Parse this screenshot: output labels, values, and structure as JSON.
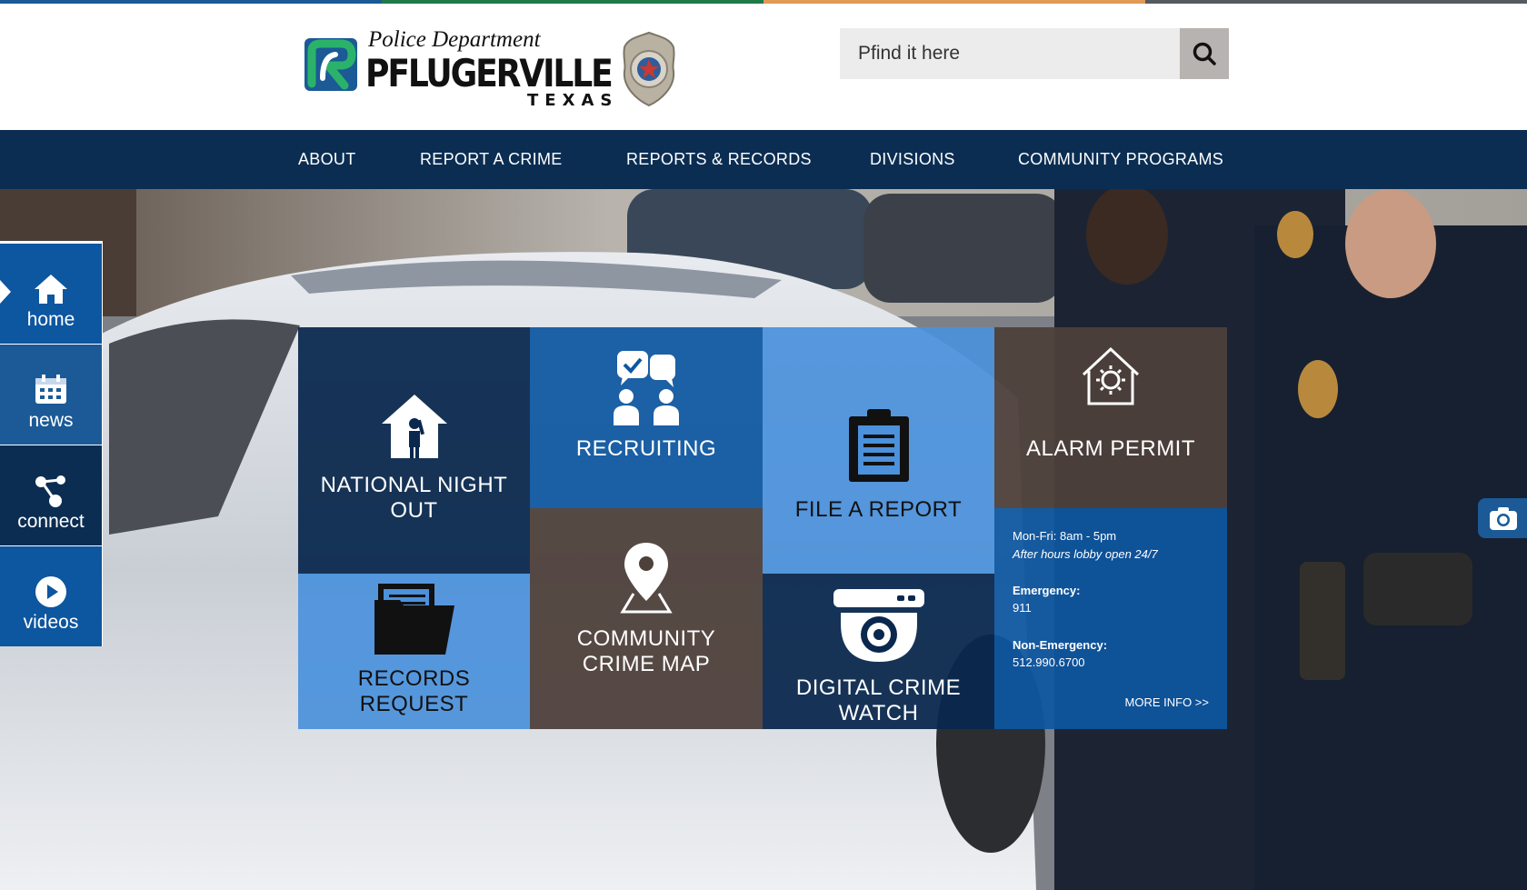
{
  "colors": {
    "stripe": [
      "#1b5a96",
      "#1f7a4a",
      "#e09a55",
      "#555a5f"
    ],
    "nav_bg": "#0b2d52",
    "tile_navy": "#0a284e",
    "tile_blue": "#0d56a0",
    "tile_light": "#4b91dc",
    "tile_brown": "#4e403a"
  },
  "logo": {
    "dept": "Police Department",
    "city": "PFLUGERVILLE",
    "state": "TEXAS",
    "badge_icon": "police-badge-icon"
  },
  "search": {
    "placeholder": "Pfind it here",
    "icon": "search-icon"
  },
  "nav": {
    "items": [
      "ABOUT",
      "REPORT A CRIME",
      "REPORTS & RECORDS",
      "DIVISIONS",
      "COMMUNITY PROGRAMS"
    ]
  },
  "sidebar": {
    "items": [
      {
        "label": "home",
        "icon": "home-icon"
      },
      {
        "label": "news",
        "icon": "calendar-icon"
      },
      {
        "label": "connect",
        "icon": "share-icon"
      },
      {
        "label": "videos",
        "icon": "play-icon"
      }
    ]
  },
  "tiles": {
    "national_night_out": "NATIONAL NIGHT OUT",
    "recruiting": "RECRUITING",
    "file_report": "FILE A REPORT",
    "alarm_permit": "ALARM PERMIT",
    "records_request": "RECORDS REQUEST",
    "crime_map": "COMMUNITY CRIME MAP",
    "crime_watch": "DIGITAL CRIME WATCH"
  },
  "info": {
    "hours": "Mon-Fri: 8am - 5pm",
    "lobby": "After hours lobby open 24/7",
    "emergency_label": "Emergency:",
    "emergency_number": "911",
    "non_emergency_label": "Non-Emergency:",
    "non_emergency_number": "512.990.6700",
    "more": "MORE INFO >>"
  },
  "camera": {
    "icon": "camera-icon"
  }
}
